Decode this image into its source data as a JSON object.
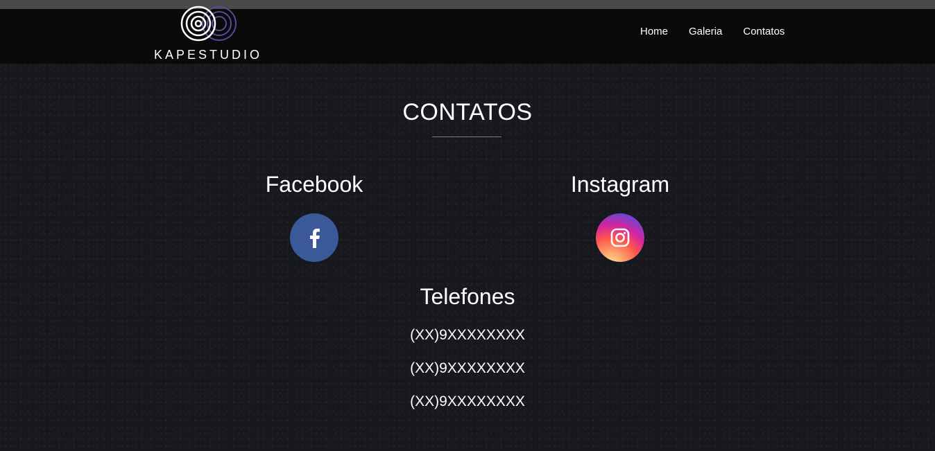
{
  "brand": {
    "name": "KAPESTUDIO"
  },
  "nav": {
    "items": [
      {
        "label": "Home"
      },
      {
        "label": "Galeria"
      },
      {
        "label": "Contatos"
      }
    ]
  },
  "contacts": {
    "title": "CONTATOS",
    "social": [
      {
        "label": "Facebook",
        "icon": "facebook-icon",
        "color": "#3b5998"
      },
      {
        "label": "Instagram",
        "icon": "instagram-icon",
        "color": "#d6249f"
      }
    ],
    "phones_heading": "Telefones",
    "phones": [
      "(XX)9XXXXXXXX",
      "(XX)9XXXXXXXX",
      "(XX)9XXXXXXXX"
    ]
  },
  "colors": {
    "background": "#16181d",
    "navbar": "#0a0a0b",
    "accent_purple": "#7a5cc7"
  }
}
